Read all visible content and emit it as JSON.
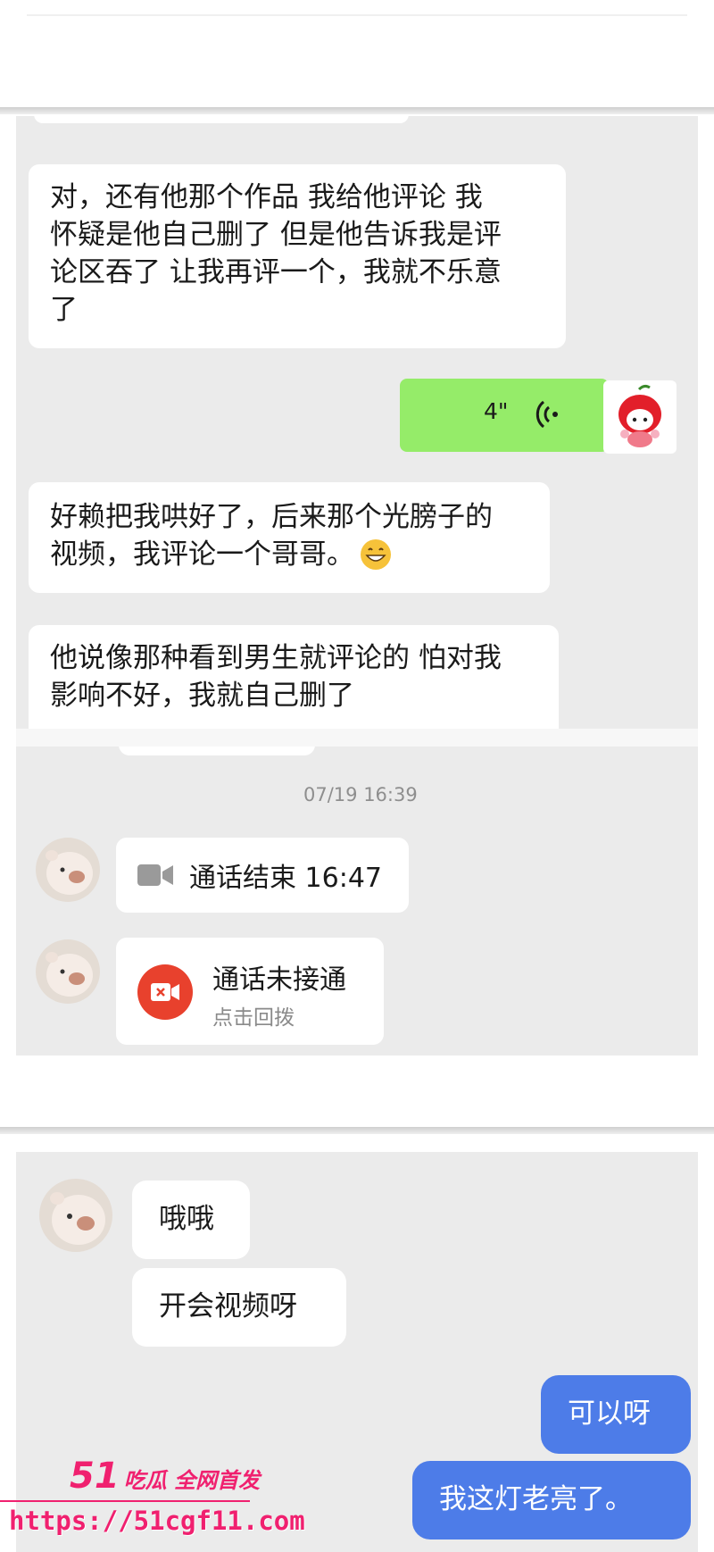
{
  "chat1": {
    "messages": [
      {
        "lines": [
          "对，还有他那个作品 我给他评论 我",
          "怀疑是他自己删了 但是他告诉我是评",
          "论区吞了 让我再评一个，我就不乐意",
          "了"
        ]
      },
      {
        "voice_duration": "4\""
      },
      {
        "lines": [
          "好赖把我哄好了，后来那个光膀子的",
          "视频，我评论一个哥哥。"
        ]
      },
      {
        "lines": [
          "他说像那种看到男生就评论的 怕对我",
          "影响不好，我就自己删了"
        ]
      }
    ]
  },
  "chat2": {
    "timestamp": "07/19 16:39",
    "call_ended": "通话结束 16:47",
    "call_missed_title": "通话未接通",
    "call_missed_action": "点击回拨"
  },
  "chat3": {
    "incoming": [
      "哦哦",
      "开会视频呀"
    ],
    "outgoing": [
      "可以呀",
      "我这灯老亮了。"
    ]
  },
  "watermark": {
    "brand": "51",
    "slogan": "吃瓜 全网首发",
    "url": "https://51cgf11.com"
  },
  "colors": {
    "chat_bg": "#ebebeb",
    "voice_green": "#95ec69",
    "blue_bubble": "#4d7ce8",
    "missed_call_red": "#e8412d",
    "watermark_pink": "#f0206f"
  }
}
